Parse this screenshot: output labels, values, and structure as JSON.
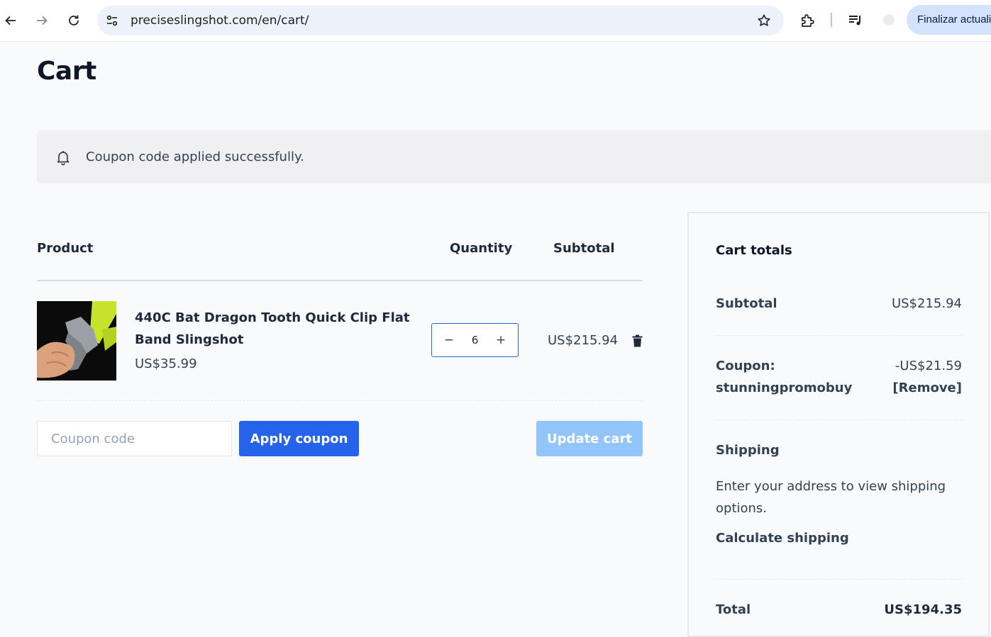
{
  "browser": {
    "url": "preciseslingshot.com/en/cart/",
    "update_button": "Finalizar actualiz"
  },
  "page": {
    "title": "Cart",
    "notice": "Coupon code applied successfully."
  },
  "table": {
    "headers": {
      "product": "Product",
      "quantity": "Quantity",
      "subtotal": "Subtotal"
    },
    "items": [
      {
        "name": "440C Bat Dragon Tooth Quick Clip Flat Band Slingshot",
        "price": "US$35.99",
        "quantity": "6",
        "subtotal": "US$215.94"
      }
    ],
    "qty_minus": "−",
    "qty_plus": "+"
  },
  "actions": {
    "coupon_placeholder": "Coupon code",
    "apply_label": "Apply coupon",
    "update_label": "Update cart"
  },
  "totals": {
    "title": "Cart totals",
    "subtotal_label": "Subtotal",
    "subtotal_value": "US$215.94",
    "coupon_label_1": "Coupon:",
    "coupon_label_2": "stunningpromobuy",
    "coupon_value": "-US$21.59",
    "coupon_remove": "[Remove]",
    "shipping_label": "Shipping",
    "shipping_text": "Enter your address to view shipping options.",
    "calculate_shipping": "Calculate shipping",
    "total_label": "Total",
    "total_value": "US$194.35"
  },
  "colors": {
    "accent": "#2563eb",
    "accent_disabled": "#93c5fd",
    "page_bg": "#f8fafc",
    "notice_bg": "#f0f0f2"
  },
  "icons": [
    "back-arrow-icon",
    "forward-arrow-icon",
    "reload-icon",
    "site-settings-icon",
    "star-icon",
    "extension-icon",
    "media-queue-icon",
    "bell-icon",
    "trash-icon"
  ]
}
